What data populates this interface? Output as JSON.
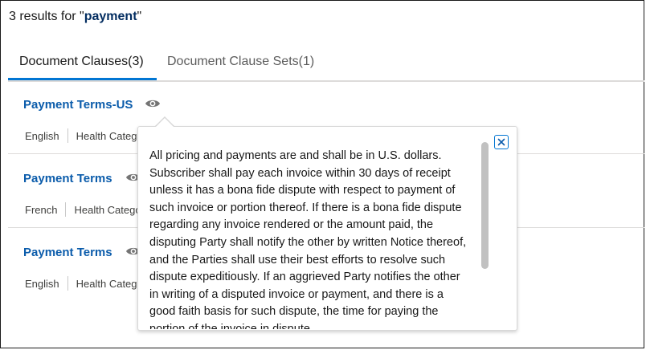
{
  "search": {
    "prefix": "3 results for \"",
    "term": "payment",
    "suffix": "\""
  },
  "tabs": [
    {
      "label": "Document Clauses(3)",
      "active": true
    },
    {
      "label": "Document Clause Sets(1)",
      "active": false
    }
  ],
  "results": [
    {
      "title": "Payment Terms-US",
      "language": "English",
      "category": "Health Catego"
    },
    {
      "title": "Payment Terms",
      "language": "French",
      "category": "Health Catego"
    },
    {
      "title": "Payment Terms",
      "language": "English",
      "category": "Health Catego"
    }
  ],
  "popover": {
    "text": "All pricing and payments are and shall be in U.S. dollars. Subscriber shall pay each invoice within 30 days of receipt unless it has a bona fide dispute with respect to payment of such invoice or portion thereof. If there is a bona fide dispute regarding any invoice rendered or the amount paid, the disputing Party shall notify the other by written Notice thereof, and the Parties shall use their best efforts to resolve such dispute expeditiously. If an aggrieved Party notifies the other in writing of a disputed invoice or payment, and there is a good faith basis for such dispute, the time for paying the portion of the invoice in dispute",
    "close_label": "Close"
  },
  "colors": {
    "accent": "#0176d3",
    "link": "#0b5cab",
    "term": "#032d60"
  },
  "icons": {
    "preview": "eye-icon",
    "close": "close-icon"
  }
}
